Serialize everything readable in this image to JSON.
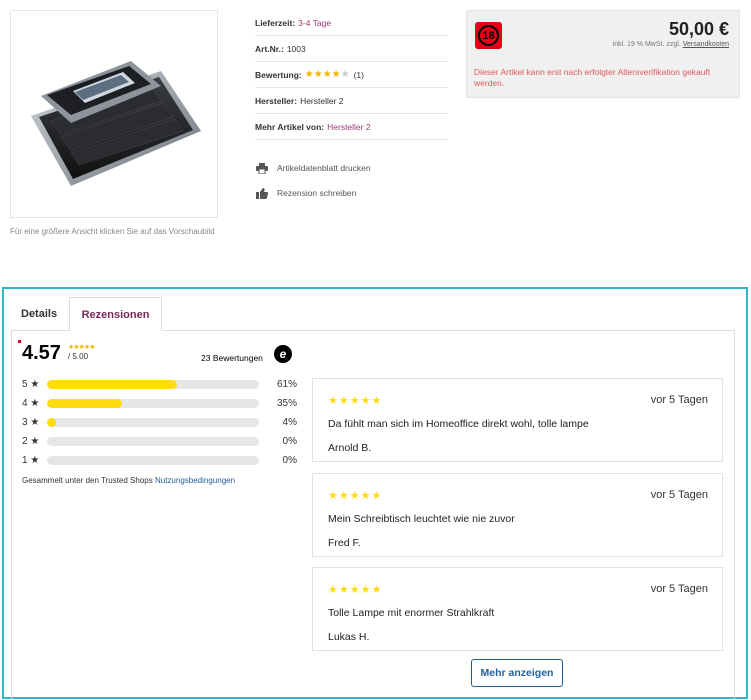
{
  "product": {
    "image_hint": "Für eine größere Ansicht klicken Sie auf das Vorschaubild",
    "delivery_label": "Lieferzeit:",
    "delivery_value": "3-4 Tage",
    "artnr_label": "Art.Nr.:",
    "artnr_value": "1003",
    "rating_label": "Bewertung:",
    "rating_count": "(1)",
    "rating_stars": 4,
    "manufacturer_label": "Hersteller:",
    "manufacturer_value": "Hersteller 2",
    "more_label": "Mehr Artikel von:",
    "more_value": "Hersteller 2",
    "print_label": "Artikeldatenblatt drucken",
    "review_label": "Rezension schreiben"
  },
  "price_box": {
    "badge": "18",
    "price": "50,00 €",
    "vat_text": "inkl. 19 % MwSt. zzgl.",
    "shipping_link": "Versandkosten",
    "age_note": "Dieser Artikel kann erst nach erfolgter Altersverifikation gekauft werden."
  },
  "tabs": [
    {
      "label": "Details",
      "active": false
    },
    {
      "label": "Rezensionen",
      "active": true
    }
  ],
  "summary": {
    "score": "4.57",
    "max": "/ 5.00",
    "mini_stars": "★★★★★",
    "count": "23 Bewertungen",
    "logo_letter": "e",
    "collected_text": "Gesammelt unter den Trusted Shops",
    "collected_link": "Nutzungsbedingungen"
  },
  "distribution": [
    {
      "label": "5 ★",
      "pct": "61%",
      "fraction": 0.61
    },
    {
      "label": "4 ★",
      "pct": "35%",
      "fraction": 0.35
    },
    {
      "label": "3 ★",
      "pct": "4%",
      "fraction": 0.04
    },
    {
      "label": "2 ★",
      "pct": "0%",
      "fraction": 0
    },
    {
      "label": "1 ★",
      "pct": "0%",
      "fraction": 0
    }
  ],
  "reviews": [
    {
      "stars": "★★★★★",
      "time": "vor 5 Tagen",
      "text": "Da fühlt man sich im Homeoffice direkt wohl, tolle lampe",
      "author": "Arnold B."
    },
    {
      "stars": "★★★★★",
      "time": "vor 5 Tagen",
      "text": "Mein Schreibtisch leuchtet wie nie zuvor",
      "author": "Fred F."
    },
    {
      "stars": "★★★★★",
      "time": "vor 5 Tagen",
      "text": "Tolle Lampe mit enormer Strahlkraft",
      "author": "Lukas H."
    }
  ],
  "more_button": "Mehr anzeigen",
  "colors": {
    "accent_purple": "#9b3a75",
    "frame_teal": "#2bb6c9",
    "star_yellow": "#ffdc0f",
    "badge_red": "#e2001a",
    "link_blue": "#1f5f9e",
    "warning_red": "#e05a5a"
  }
}
